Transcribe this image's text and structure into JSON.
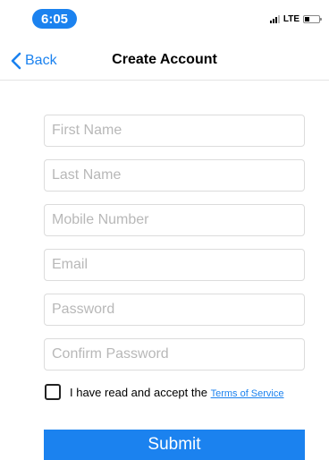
{
  "status_bar": {
    "time": "6:05",
    "network": "LTE",
    "battery_level": 0.3
  },
  "nav": {
    "back_label": "Back",
    "title": "Create Account"
  },
  "form": {
    "first_name_placeholder": "First Name",
    "last_name_placeholder": "Last Name",
    "mobile_placeholder": "Mobile Number",
    "email_placeholder": "Email",
    "password_placeholder": "Password",
    "confirm_password_placeholder": "Confirm Password"
  },
  "terms": {
    "checked": false,
    "text": "I have read and accept the",
    "link_label": "Terms of Service"
  },
  "submit_label": "Submit",
  "colors": {
    "accent": "#1b82ef"
  }
}
